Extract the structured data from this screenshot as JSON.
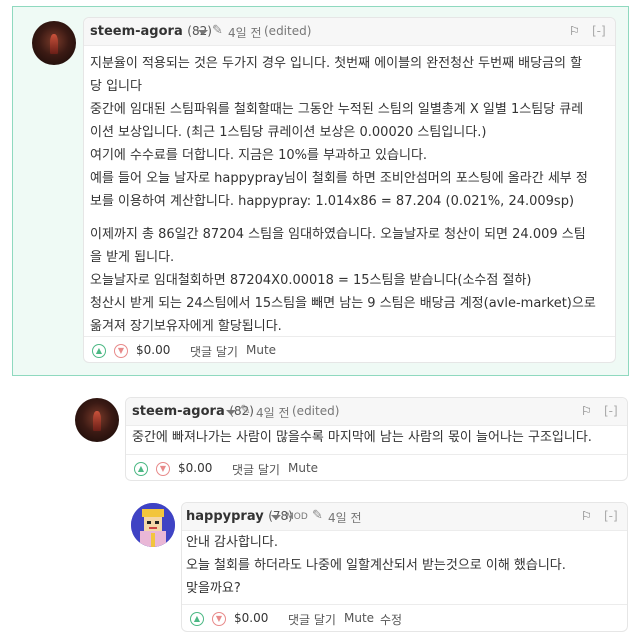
{
  "comments": [
    {
      "author": "steem-agora",
      "reputation": "(82)",
      "time": "4일 전",
      "edited": "(edited)",
      "collapse": "[-]",
      "body": [
        "지분율이 적용되는 것은 두가지 경우 입니다. 첫번째 에이블의 완전청산 두번째 배당금의 할",
        "당 입니다",
        "중간에 임대된 스팀파워를 철회할때는 그동안 누적된 스팀의 일별총계 X 일별 1스팀당 큐레",
        "이션 보상입니다. (최근 1스팀당 큐레이션 보상은 0.00020 스팀입니다.)",
        "여기에 수수료를 더합니다. 지금은 10%를 부과하고 있습니다.",
        "예를 들어 오늘 날자로 happypray님이 철회를 하면 조비안섬머의 포스팅에 올라간 세부 정",
        "보를 이용하여 계산합니다. happypray: 1.014x86 = 87.204 (0.021%, 24.009sp)",
        "이제까지 총 86일간 87204 스팀을 임대하였습니다. 오늘날자로 청산이 되면 24.009 스팀",
        "을 받게 됩니다.",
        "오늘날자로 임대철회하면 87204X0.00018 = 15스팀을 받습니다(소수점 절하)",
        "청산시 받게 되는 24스팀에서 15스팀을 빼면 남는 9 스팀은 배당금 계정(avle-market)으로",
        "옮겨져 장기보유자에게 할당됩니다."
      ],
      "payout": "$0.00",
      "reply": "댓글 달기",
      "mute": "Mute"
    },
    {
      "author": "steem-agora",
      "reputation": "(82)",
      "time": "4일 전",
      "edited": "(edited)",
      "collapse": "[-]",
      "body": [
        "중간에 빠져나가는 사람이 많을수록 마지막에 남는 사람의 몫이 늘어나는 구조입니다."
      ],
      "payout": "$0.00",
      "reply": "댓글 달기",
      "mute": "Mute"
    },
    {
      "author": "happypray",
      "reputation": "(78)",
      "mod": "MOD",
      "time": "4일 전",
      "collapse": "[-]",
      "body": [
        "안내 감사합니다.",
        "오늘 철회를 하더라도 나중에 일할계산되서 받는것으로 이해 했습니다.",
        "맞을까요?"
      ],
      "payout": "$0.00",
      "reply": "댓글 달기",
      "mute": "Mute",
      "edit": "수정"
    }
  ]
}
